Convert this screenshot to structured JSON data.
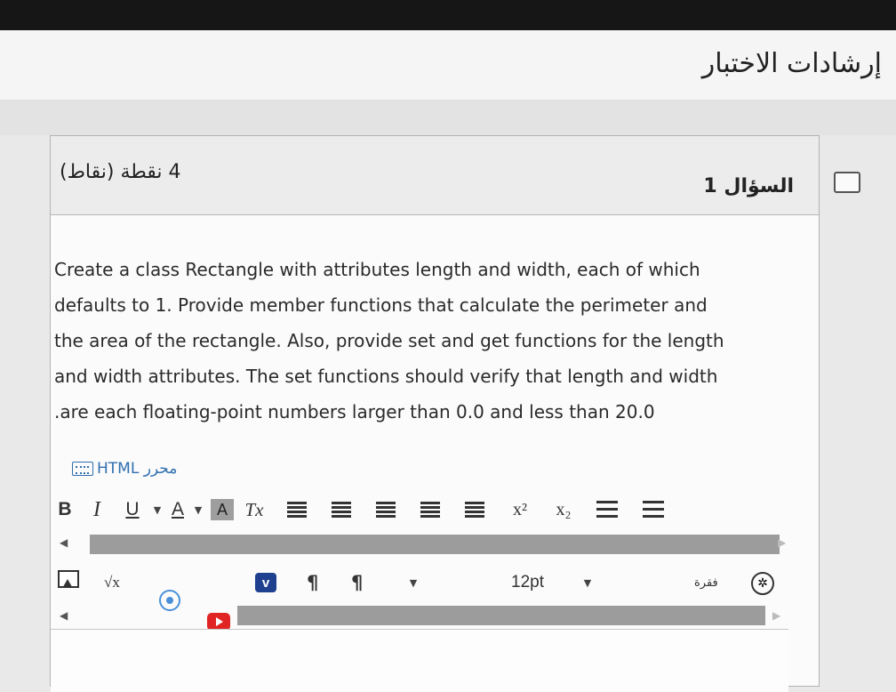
{
  "page": {
    "title": "إرشادات الاختبار"
  },
  "question": {
    "number_label": "السؤال 1",
    "points_label": "4 نقطة (نقاط)",
    "text_lines": [
      "Create a class Rectangle with attributes length and width, each of which",
      "defaults to 1. Provide member functions that calculate the perimeter and",
      "the area of the rectangle. Also, provide set and get functions for the length",
      "and width attributes. The set functions should verify that length and width",
      ".are each floating-point numbers larger than 0.0 and less than 20.0"
    ]
  },
  "editor": {
    "html_editor_label": "محرر HTML",
    "toolbar1": {
      "bold": "B",
      "italic": "I",
      "underline": "U",
      "font_color": "A",
      "bg_color": "A",
      "clear_format": "Tx",
      "superscript": "x²",
      "subscript": "x₂"
    },
    "toolbar2": {
      "sqrt": "√x",
      "vimeo": "v",
      "ltr": "¶",
      "rtl": "¶",
      "font_size": "12pt",
      "paragraph": "فقرة",
      "accessibility": "✲"
    },
    "colors": {
      "accent": "#2f6fb0",
      "youtube": "#e02424",
      "vimeo": "#1f3f8f"
    }
  }
}
